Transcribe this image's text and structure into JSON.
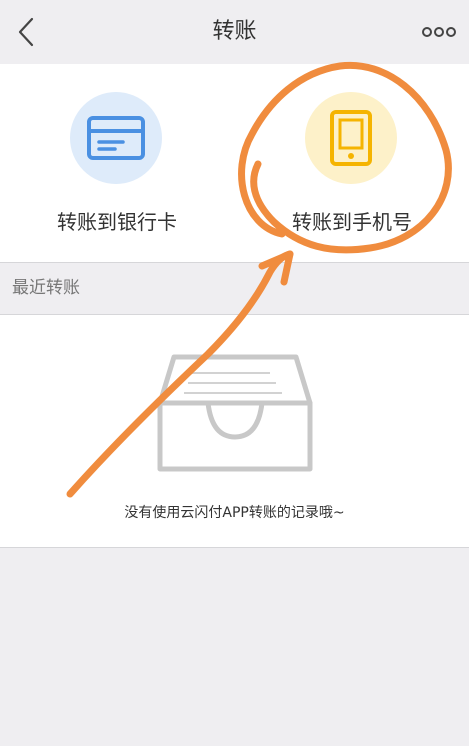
{
  "header": {
    "title": "转账",
    "back_icon": "chevron-left-icon",
    "more_icon": "more-dots-icon"
  },
  "actions": [
    {
      "label": "转账到银行卡",
      "icon": "bank-card-icon",
      "accent": "#4a90e2"
    },
    {
      "label": "转账到手机号",
      "icon": "mobile-phone-icon",
      "accent": "#f5b400"
    }
  ],
  "recent": {
    "section_title": "最近转账",
    "empty_message": "没有使用云闪付APP转账的记录哦~",
    "empty_icon": "empty-tray-icon"
  },
  "colors": {
    "background": "#efeef1",
    "annotation": "#f08c3e"
  }
}
